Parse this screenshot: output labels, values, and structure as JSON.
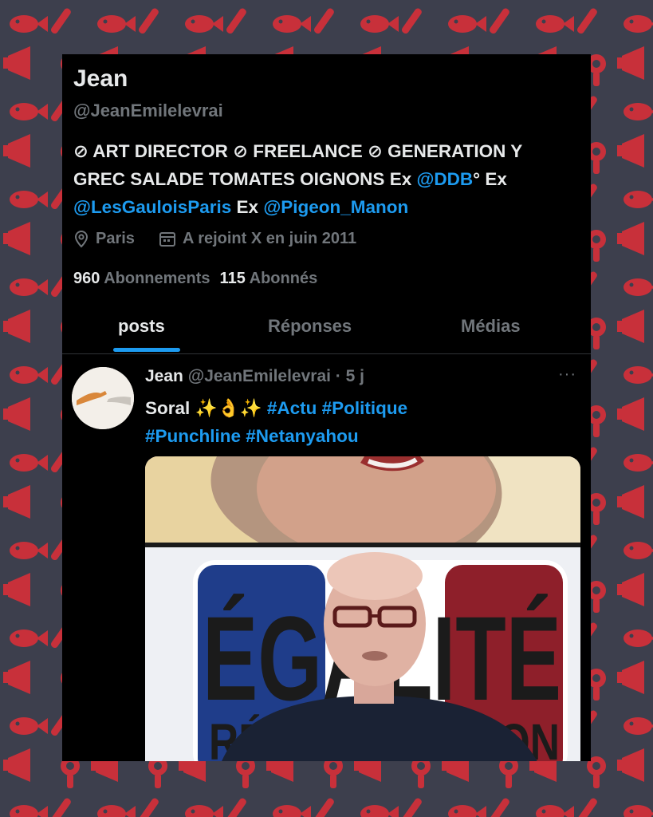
{
  "profile": {
    "name": "Jean",
    "handle": "@JeanEmilelevrai",
    "bio": {
      "line1_part1": "⊘ ART DIRECTOR ⊘ FREELANCE ⊘ GENERATION Y",
      "line2_part1": "GREC SALADE TOMATES OIGNONS Ex ",
      "link_ddb": "@DDB",
      "line2_part2": "° Ex",
      "link_gaulois": "@LesGauloisParis",
      "line3_mid": " Ex ",
      "link_pigeon": "@Pigeon_Manon"
    },
    "location": "Paris",
    "joined": "A rejoint X en juin 2011",
    "following_count": "960",
    "following_label": "Abonnements",
    "followers_count": "115",
    "followers_label": "Abonnés"
  },
  "tabs": [
    {
      "label": "posts",
      "active": true
    },
    {
      "label": "Réponses",
      "active": false
    },
    {
      "label": "Médias",
      "active": false
    }
  ],
  "post": {
    "author": "Jean",
    "handle": "@JeanEmilelevrai",
    "dot": " · ",
    "time": "5 j",
    "text_start": "Soral ",
    "emoji_sparkles": "✨",
    "emoji_hand": "👌",
    "tag1": "#Actu",
    "tag2": "#Politique",
    "tag3": "#Punchline",
    "tag4": "#Netanyahou",
    "more": "···",
    "media_text": "ÉGALITÉ RÉCONCILIATION"
  },
  "colors": {
    "background": "#3d3f4d",
    "pattern": "#c8303a",
    "panel": "#000000",
    "link": "#1d9bf0",
    "muted": "#71767b",
    "text": "#e7e9ea"
  },
  "icons": [
    "location-pin-icon",
    "calendar-icon",
    "more-options-icon"
  ]
}
